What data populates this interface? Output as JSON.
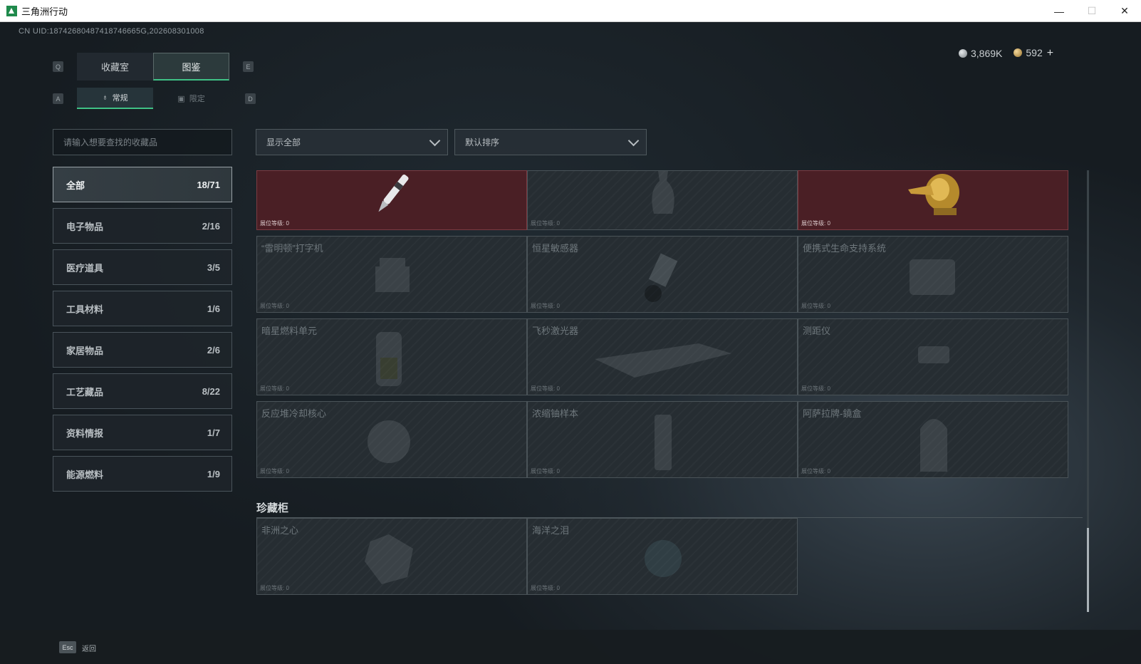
{
  "window": {
    "title": "三角洲行动",
    "controls": {
      "minimize": "—",
      "maximize": "☐",
      "close": "✕"
    }
  },
  "uid": "CN UID:18742680487418746665G,202608301008",
  "currency": {
    "silver": "3,869K",
    "gold": "592",
    "add": "+"
  },
  "keys": {
    "prev_tab": "Q",
    "next_tab": "E",
    "prev_sub": "A",
    "next_sub": "D"
  },
  "tabs": [
    {
      "label": "收藏室"
    },
    {
      "label": "图鉴"
    }
  ],
  "subtabs": [
    {
      "label": "常规",
      "icon": "item-icon"
    },
    {
      "label": "限定",
      "icon": "image-icon"
    }
  ],
  "search": {
    "placeholder": "请输入想要查找的收藏品"
  },
  "filters": {
    "show": "显示全部",
    "sort": "默认排序"
  },
  "categories": [
    {
      "label": "全部",
      "count": "18/71"
    },
    {
      "label": "电子物品",
      "count": "2/16"
    },
    {
      "label": "医疗道具",
      "count": "3/5"
    },
    {
      "label": "工具材料",
      "count": "1/6"
    },
    {
      "label": "家居物品",
      "count": "2/6"
    },
    {
      "label": "工艺藏品",
      "count": "8/22"
    },
    {
      "label": "资料情报",
      "count": "1/7"
    },
    {
      "label": "能源燃料",
      "count": "1/9"
    }
  ],
  "grade_label": "展位等级:",
  "grade_value": "0",
  "items": [
    {
      "name": "",
      "owned": true,
      "icon": "fountain-pen-icon"
    },
    {
      "name": "",
      "owned": false,
      "icon": "vase-icon"
    },
    {
      "name": "",
      "owned": true,
      "icon": "golden-crocodile-icon"
    },
    {
      "name": "“雷明顿”打字机",
      "owned": false,
      "icon": "typewriter-icon"
    },
    {
      "name": "恒星敏感器",
      "owned": false,
      "icon": "sensor-icon"
    },
    {
      "name": "便携式生命支持系统",
      "owned": false,
      "icon": "life-support-icon"
    },
    {
      "name": "暗星燃料单元",
      "owned": false,
      "icon": "fuel-cell-icon"
    },
    {
      "name": "飞秒激光器",
      "owned": false,
      "icon": "laser-icon"
    },
    {
      "name": "测距仪",
      "owned": false,
      "icon": "rangefinder-icon"
    },
    {
      "name": "反应堆冷却核心",
      "owned": false,
      "icon": "reactor-core-icon"
    },
    {
      "name": "浓缩铀样本",
      "owned": false,
      "icon": "uranium-sample-icon"
    },
    {
      "name": "阿萨拉牌-鐃盒",
      "owned": false,
      "icon": "arch-box-icon"
    }
  ],
  "treasure_section": "珍藏柜",
  "treasure_items": [
    {
      "name": "非洲之心",
      "icon": "heart-of-africa-icon"
    },
    {
      "name": "海洋之泪",
      "icon": "ocean-tear-icon"
    }
  ],
  "footer": {
    "esc": "Esc",
    "back": "返回"
  },
  "colors": {
    "accent": "#3fc286",
    "owned_bg": "#4a1f25",
    "card_bg": "#262d32"
  }
}
